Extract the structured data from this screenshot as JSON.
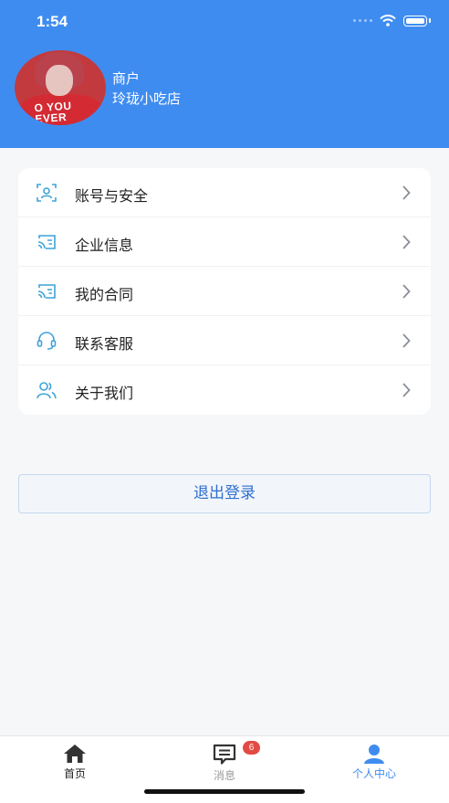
{
  "status_bar": {
    "time": "1:54"
  },
  "profile": {
    "role": "商户",
    "shop_name": "玲珑小吃店",
    "avatar_shirt_text": "O YOU\nEVER"
  },
  "menu": {
    "items": [
      {
        "label": "账号与安全",
        "icon": "account-security-icon"
      },
      {
        "label": "企业信息",
        "icon": "enterprise-info-icon"
      },
      {
        "label": "我的合同",
        "icon": "contract-icon"
      },
      {
        "label": "联系客服",
        "icon": "headset-icon"
      },
      {
        "label": "关于我们",
        "icon": "users-icon"
      }
    ]
  },
  "logout_label": "退出登录",
  "tabbar": {
    "tabs": [
      {
        "label": "首页",
        "icon": "home-icon",
        "active": false
      },
      {
        "label": "消息",
        "icon": "message-icon",
        "active": false,
        "badge": "6"
      },
      {
        "label": "个人中心",
        "icon": "person-icon",
        "active": true
      }
    ]
  },
  "colors": {
    "header": "#3f8cf0",
    "accent": "#2f6fd0",
    "icon": "#3fa3d8",
    "badge": "#e34a43"
  }
}
